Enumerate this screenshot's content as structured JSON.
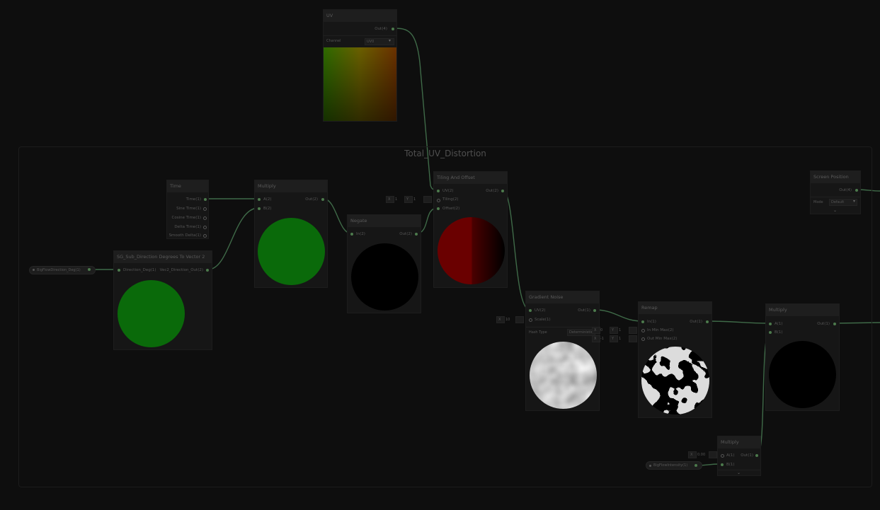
{
  "group": {
    "title": "Total_UV_Distortion"
  },
  "nodes": {
    "uv": {
      "title": "UV",
      "out": "Out(4)",
      "channel_label": "Channel",
      "channel_value": "UV0"
    },
    "time": {
      "title": "Time",
      "outputs": [
        "Time(1)",
        "Sine Time(1)",
        "Cosine Time(1)",
        "Delta Time(1)",
        "Smooth Delta(1)"
      ]
    },
    "sg_sub": {
      "title": "SG_Sub_Direction Degrees To Vector 2",
      "in": "Direction_Deg(1)",
      "out": "Vec2_Direction_Out(2)"
    },
    "multiply1": {
      "title": "Multiply",
      "in_a": "A(2)",
      "in_b": "B(2)",
      "out": "Out(2)"
    },
    "negate": {
      "title": "Negate",
      "in": "In(2)",
      "out": "Out(2)"
    },
    "tiling": {
      "title": "Tiling And Offset",
      "in_uv": "UV(2)",
      "in_tiling": "Tiling(2)",
      "in_offset": "Offset(2)",
      "out": "Out(2)"
    },
    "screen_pos": {
      "title": "Screen Position",
      "out": "Out(4)",
      "mode_label": "Mode",
      "mode_value": "Default"
    },
    "gradient": {
      "title": "Gradient Noise",
      "in_uv": "UV(2)",
      "in_scale": "Scale(1)",
      "out": "Out(1)",
      "hash_label": "Hash Type",
      "hash_value": "Deterministic"
    },
    "remap": {
      "title": "Remap",
      "in": "In(1)",
      "in_minmax": "In Min Max(2)",
      "out_minmax": "Out Min Max(2)",
      "out": "Out(1)"
    },
    "multiply2": {
      "title": "Multiply",
      "in_a": "A(1)",
      "in_b": "B(1)",
      "out": "Out(1)"
    },
    "multiply3": {
      "title": "Multiply",
      "in_a": "A(1)",
      "in_b": "B(1)",
      "out": "Out(1)"
    }
  },
  "inline_fields": {
    "tiling_x_label": "X",
    "tiling_x": "1",
    "tiling_y_label": "Y",
    "tiling_y": "1",
    "scale_x_label": "X",
    "scale_x": "10",
    "remap_in_x_label": "X",
    "remap_in_x": "0",
    "remap_in_y_label": "Y",
    "remap_in_y": "1",
    "remap_out_x_label": "X",
    "remap_out_x": "-1",
    "remap_out_y_label": "Y",
    "remap_out_y": "1",
    "mult_x_label": "X",
    "mult_x": "0.00"
  },
  "properties": {
    "direction": "BigFlowDirection_Deg(1)",
    "intensity": "BigFlowIntensity(1)"
  },
  "colors": {
    "background": "#0e0e0e",
    "wire": "#3f6a48",
    "preview_green": "#0a6a0a",
    "preview_red": "#6a0000",
    "port_dot": "#4c7a4c"
  },
  "icons": {
    "dropdown": "chevron-down-icon",
    "expand": "chevron-down-icon",
    "property_pill": "blackboard-property-pill"
  }
}
